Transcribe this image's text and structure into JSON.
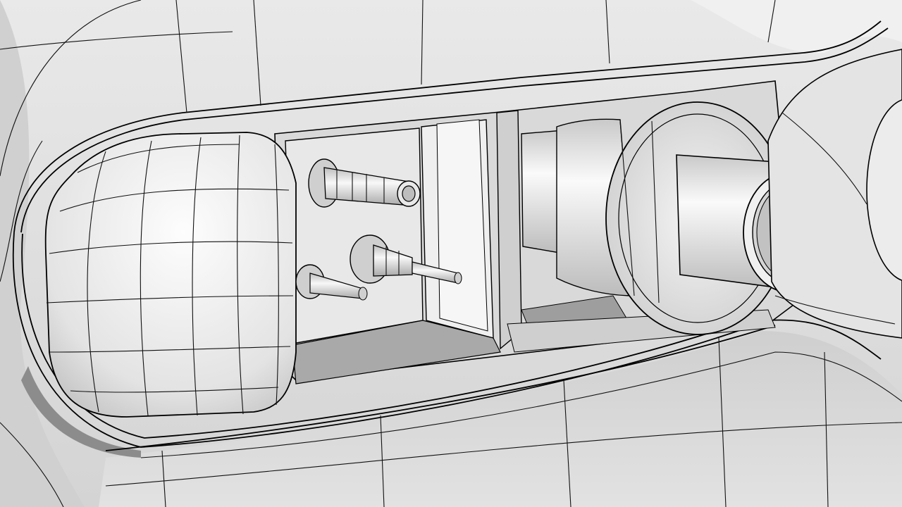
{
  "scene": {
    "type": "cad-model-mesh-view",
    "colors": {
      "surface_light": "#f4f4f4",
      "surface_mid": "#dcdcdc",
      "surface_dark": "#b8b8b8",
      "cavity_shadow": "#9a9a9a",
      "mesh_line": "#111111"
    }
  }
}
